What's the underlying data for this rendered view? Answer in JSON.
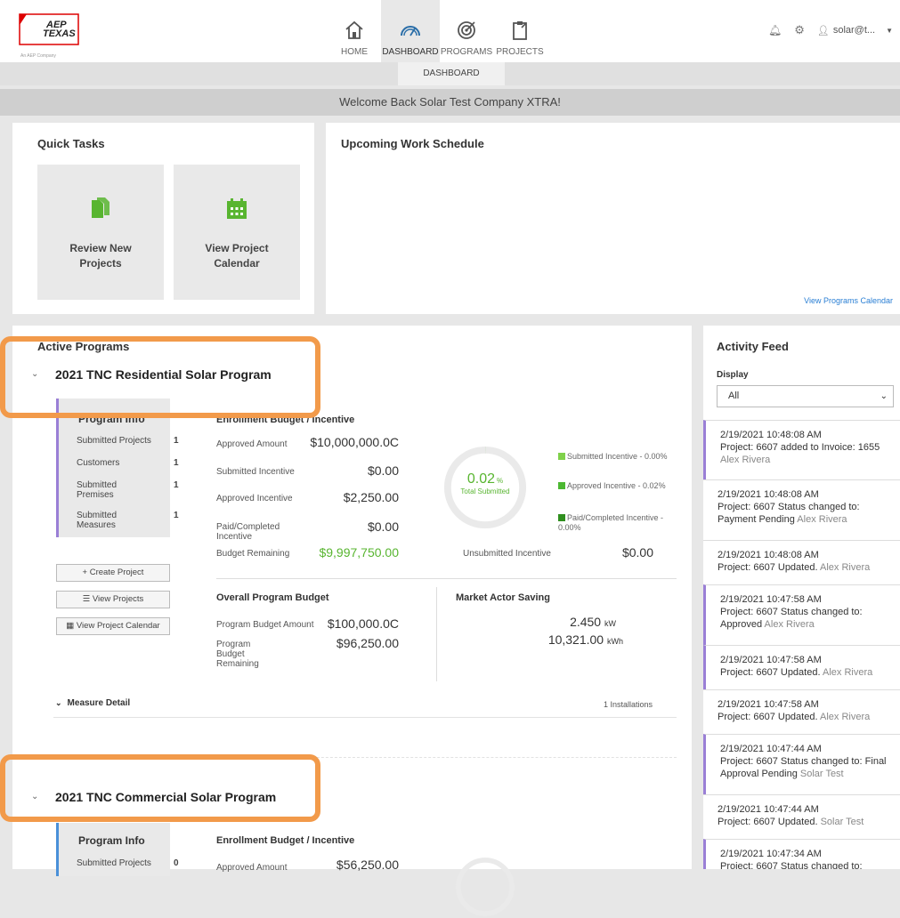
{
  "brand": {
    "name_line1": "AEP",
    "name_line2": "TEXAS",
    "tagline": "An AEP Company"
  },
  "nav": [
    {
      "label": "HOME",
      "icon": "home-icon"
    },
    {
      "label": "DASHBOARD",
      "icon": "gauge-icon",
      "active": true
    },
    {
      "label": "PROGRAMS",
      "icon": "target-icon"
    },
    {
      "label": "PROJECTS",
      "icon": "clipboard-icon"
    }
  ],
  "user": {
    "name": "solar@t...",
    "icons": [
      "bell-icon",
      "gear-icon",
      "user-icon",
      "caret-down-icon"
    ]
  },
  "subnav": {
    "active": "DASHBOARD"
  },
  "welcome": "Welcome Back Solar Test Company XTRA!",
  "quick_tasks": {
    "title": "Quick Tasks",
    "tasks": [
      {
        "line1": "Review New",
        "line2": "Projects",
        "icon": "documents-icon"
      },
      {
        "line1": "View Project",
        "line2": "Calendar",
        "icon": "calendar-icon"
      }
    ]
  },
  "schedule": {
    "title": "Upcoming Work Schedule",
    "link": "View Programs Calendar"
  },
  "active_programs": {
    "title": "Active Programs"
  },
  "programs": [
    {
      "name": "2021 TNC Residential Solar Program",
      "info_title": "Program Info",
      "info": [
        {
          "label": "Submitted Projects",
          "value": "1"
        },
        {
          "label": "Customers",
          "value": "1"
        },
        {
          "label": "Submitted Premises",
          "value": "1"
        },
        {
          "label": "Submitted Measures",
          "value": "1"
        }
      ],
      "buttons": [
        "+ Create Project",
        "☰ View Projects",
        "▦ View Project Calendar"
      ],
      "enrollment_title": "Enrollment Budget / Incentive",
      "enrollment": [
        {
          "label": "Approved Amount",
          "value": "$10,000,000.0C"
        },
        {
          "label": "Submitted Incentive",
          "value": "$0.00"
        },
        {
          "label": "Approved Incentive",
          "value": "$2,250.00"
        },
        {
          "label": "Paid/Completed Incentive",
          "value": "$0.00"
        },
        {
          "label": "Budget Remaining",
          "value": "$9,997,750.00"
        }
      ],
      "gauge": {
        "value": "0.02",
        "unit": "%",
        "caption": "Total Submitted",
        "fraction": 0.0002
      },
      "legend": [
        {
          "text": "Submitted Incentive - 0.00%",
          "color": "#7fd14a"
        },
        {
          "text": "Approved Incentive - 0.02%",
          "color": "#4cb832"
        },
        {
          "text": "Paid/Completed Incentive - 0.00%",
          "color": "#2f8f1e"
        }
      ],
      "unsubmitted": {
        "label": "Unsubmitted Incentive",
        "value": "$0.00"
      },
      "overall_title": "Overall Program Budget",
      "overall": [
        {
          "label": "Program Budget Amount",
          "value": "$100,000.0C"
        },
        {
          "label": "Program Budget Remaining",
          "value": "$96,250.00"
        }
      ],
      "saving_title": "Market Actor Saving",
      "saving": [
        {
          "value": "2.450",
          "unit": "kW"
        },
        {
          "value": "10,321.00",
          "unit": "kWh"
        }
      ],
      "measure_detail": "Measure Detail",
      "installations": "1 Installations"
    },
    {
      "name": "2021 TNC Commercial Solar Program",
      "info_title": "Program Info",
      "info": [
        {
          "label": "Submitted Projects",
          "value": "0"
        }
      ],
      "enrollment_title": "Enrollment Budget / Incentive",
      "enrollment": [
        {
          "label": "Approved Amount",
          "value": "$56,250.00"
        }
      ]
    }
  ],
  "activity": {
    "title": "Activity Feed",
    "display_label": "Display",
    "display_value": "All",
    "items": [
      {
        "time": "2/19/2021 10:48:08 AM",
        "text": "Project: 6607 added to Invoice: 1655",
        "user": "Alex Rivera"
      },
      {
        "time": "2/19/2021 10:48:08 AM",
        "text": "Project: 6607 Status changed to: Payment Pending",
        "user": "Alex Rivera"
      },
      {
        "time": "2/19/2021 10:48:08 AM",
        "text": "Project: 6607 Updated.",
        "user": "Alex Rivera"
      },
      {
        "time": "2/19/2021 10:47:58 AM",
        "text": "Project: 6607 Status changed to: Approved",
        "user": "Alex Rivera"
      },
      {
        "time": "2/19/2021 10:47:58 AM",
        "text": "Project: 6607 Updated.",
        "user": "Alex Rivera"
      },
      {
        "time": "2/19/2021 10:47:58 AM",
        "text": "Project: 6607 Updated.",
        "user": "Alex Rivera"
      },
      {
        "time": "2/19/2021 10:47:44 AM",
        "text": "Project: 6607 Status changed to: Final Approval Pending",
        "user": "Solar Test"
      },
      {
        "time": "2/19/2021 10:47:44 AM",
        "text": "Project: 6607 Updated.",
        "user": "Solar Test"
      },
      {
        "time": "2/19/2021 10:47:34 AM",
        "text": "Project: 6607 Status changed to:",
        "user": ""
      }
    ]
  },
  "colors": {
    "accent_green": "#58b530",
    "purple": "#9a7fd6",
    "highlight": "#f29a4a",
    "link": "#2a7fd4"
  }
}
